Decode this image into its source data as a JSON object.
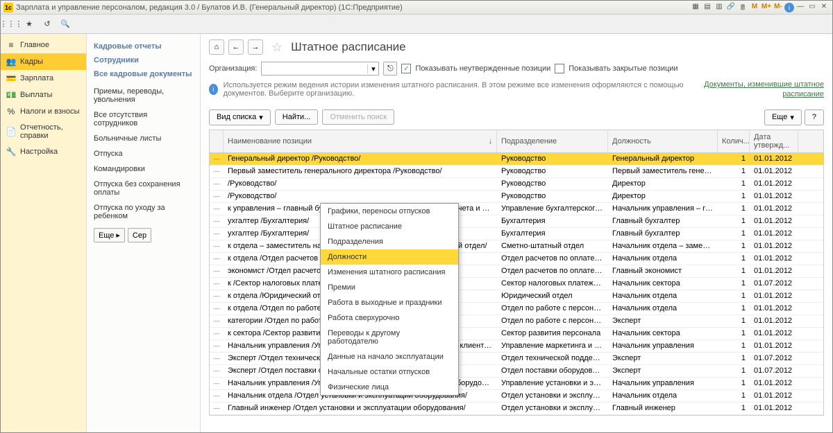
{
  "titlebar": {
    "title": "Зарплата и управление персоналом, редакция 3.0 / Булатов И.В. (Генеральный директор)  (1С:Предприятие)"
  },
  "nav": [
    {
      "icon": "≡",
      "label": "Главное"
    },
    {
      "icon": "👥",
      "label": "Кадры"
    },
    {
      "icon": "💳",
      "label": "Зарплата"
    },
    {
      "icon": "💵",
      "label": "Выплаты"
    },
    {
      "icon": "%",
      "label": "Налоги и взносы"
    },
    {
      "icon": "📄",
      "label": "Отчетность, справки"
    },
    {
      "icon": "🔧",
      "label": "Настройка"
    }
  ],
  "subnav": {
    "heads": [
      "Кадровые отчеты",
      "Сотрудники",
      "Все кадровые документы"
    ],
    "links": [
      "Приемы, переводы, увольнения",
      "Все отсутствия сотрудников",
      "Больничные листы",
      "Отпуска",
      "Командировки",
      "Отпуска без сохранения оплаты",
      "Отпуска по уходу за ребенком"
    ],
    "more": "Еще",
    "serv": "Сер"
  },
  "page": {
    "title": "Штатное расписание",
    "org_label": "Организация:",
    "chk1": "Показывать неутвержденные позиции",
    "chk2": "Показывать закрытые позиции",
    "info": "Используется режим ведения истории изменения штатного расписания. В этом режиме все изменения оформляются с помощью документов. Выберите организацию.",
    "rlink": "Документы, изменившие штатное расписание",
    "btn_view": "Вид списка",
    "btn_find": "Найти...",
    "btn_cancel": "Отменить поиск",
    "btn_more": "Еще"
  },
  "columns": [
    "Наименование позиции",
    "Подразделение",
    "Должность",
    "Колич...",
    "Дата утвержд..."
  ],
  "rows": [
    {
      "name": "Генеральный директор /Руководство/",
      "dep": "Руководство",
      "pos": "Генеральный директор",
      "qty": "1",
      "date": "01.01.2012",
      "active": true
    },
    {
      "name": "Первый заместитель генерального директора /Руководство/",
      "dep": "Руководство",
      "pos": "Первый заместитель генерального...",
      "qty": "1",
      "date": "01.01.2012"
    },
    {
      "name": "/Руководство/",
      "dep": "Руководство",
      "pos": "Директор",
      "qty": "1",
      "date": "01.01.2012"
    },
    {
      "name": "/Руководство/",
      "dep": "Руководство",
      "pos": "Директор",
      "qty": "1",
      "date": "01.01.2012"
    },
    {
      "name": "к управления – главный бухгалтер /Управление бухгалтерского учета и отчетности/",
      "dep": "Управление бухгалтерского учета и...",
      "pos": "Начальник управления – главный ...",
      "qty": "1",
      "date": "01.01.2012"
    },
    {
      "name": "ухгалтер /Бухгалтерия/",
      "dep": "Бухгалтерия",
      "pos": "Главный бухгалтер",
      "qty": "1",
      "date": "01.01.2012"
    },
    {
      "name": "ухгалтер /Бухгалтерия/",
      "dep": "Бухгалтерия",
      "pos": "Главный бухгалтер",
      "qty": "1",
      "date": "01.01.2012"
    },
    {
      "name": "к отдела – заместитель начальника управления /Сметно-штатный отдел/",
      "dep": "Сметно-штатный отдел",
      "pos": "Начальник отдела – заместитель ...",
      "qty": "1",
      "date": "01.01.2012"
    },
    {
      "name": "к отдела /Отдел расчетов по оплате труда/",
      "dep": "Отдел расчетов по оплате труда",
      "pos": "Начальник отдела",
      "qty": "1",
      "date": "01.01.2012"
    },
    {
      "name": "экономист /Отдел расчетов по оплате труда/",
      "dep": "Отдел расчетов по оплате труда",
      "pos": "Главный экономист",
      "qty": "1",
      "date": "01.01.2012"
    },
    {
      "name": "к /Сектор налоговых платежей и расчетов с фондами/",
      "dep": "Сектор налоговых платежей и рас...",
      "pos": "Начальник сектора",
      "qty": "1",
      "date": "01.07.2012"
    },
    {
      "name": "к отдела /Юридический отдел/",
      "dep": "Юридический отдел",
      "pos": "Начальник отдела",
      "qty": "1",
      "date": "01.01.2012"
    },
    {
      "name": "к отдела /Отдел по работе с персоналом/",
      "dep": "Отдел по работе с персоналом",
      "pos": "Начальник отдела",
      "qty": "1",
      "date": "01.01.2012"
    },
    {
      "name": "категории /Отдел по работе с персоналом/",
      "dep": "Отдел по работе с персоналом",
      "pos": "Эксперт",
      "qty": "1",
      "date": "01.01.2012"
    },
    {
      "name": "к сектора /Сектор развития персонала/",
      "dep": "Сектор развития персонала",
      "pos": "Начальник сектора",
      "qty": "1",
      "date": "01.01.2012"
    },
    {
      "name": "Начальник управления /Управление маркетинга и обслуживания клиентов/",
      "dep": "Управление маркетинга и обслужи...",
      "pos": "Начальник управления",
      "qty": "1",
      "date": "01.01.2012"
    },
    {
      "name": "Эксперт /Отдел технической поддержки и работы с заявками/",
      "dep": "Отдел технической поддержки и р...",
      "pos": "Эксперт",
      "qty": "1",
      "date": "01.07.2012"
    },
    {
      "name": "Эксперт /Отдел поставки оборудования/",
      "dep": "Отдел поставки оборудования",
      "pos": "Эксперт",
      "qty": "1",
      "date": "01.07.2012"
    },
    {
      "name": "Начальник управления /Управление установки и эксплуатации оборудования/",
      "dep": "Управление установки и эксплуат...",
      "pos": "Начальник управления",
      "qty": "1",
      "date": "01.01.2012"
    },
    {
      "name": "Начальник отдела /Отдел установки и эксплуатации оборудования/",
      "dep": "Отдел установки и эксплуатации о...",
      "pos": "Начальник отдела",
      "qty": "1",
      "date": "01.01.2012"
    },
    {
      "name": "Главный инженер /Отдел установки и эксплуатации оборудования/",
      "dep": "Отдел установки и эксплуатации о...",
      "pos": "Главный инженер",
      "qty": "1",
      "date": "01.01.2012"
    }
  ],
  "popup": [
    "Графики, переносы отпусков",
    "Штатное расписание",
    "Подразделения",
    "Должности",
    "Изменения штатного расписания",
    "Премии",
    "Работа в выходные и праздники",
    "Работа сверхурочно",
    "Переводы к другому работодателю",
    "Данные на начало эксплуатации",
    "Начальные остатки отпусков",
    "Физические лица"
  ]
}
